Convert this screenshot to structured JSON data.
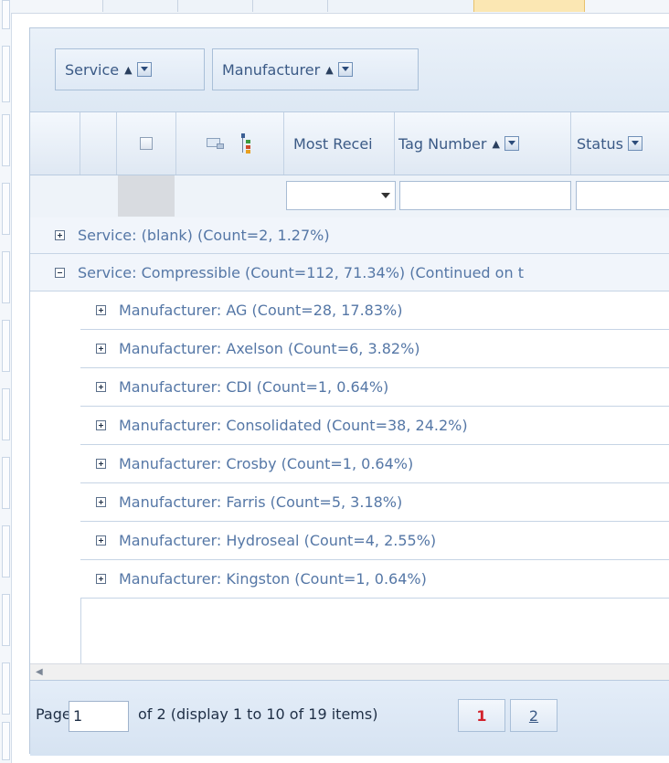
{
  "groupbar": {
    "chips": [
      {
        "label": "Service"
      },
      {
        "label": "Manufacturer"
      }
    ]
  },
  "columns": {
    "most_recent": "Most Recei",
    "tag_number": "Tag Number",
    "status": "Status"
  },
  "groups": {
    "blank": "Service: (blank) (Count=2, 1.27%)",
    "compressible": "Service: Compressible (Count=112, 71.34%) (Continued on t"
  },
  "manufacturers": [
    "Manufacturer: AG (Count=28, 17.83%)",
    "Manufacturer: Axelson (Count=6, 3.82%)",
    "Manufacturer: CDI (Count=1, 0.64%)",
    "Manufacturer: Consolidated (Count=38, 24.2%)",
    "Manufacturer: Crosby (Count=1, 0.64%)",
    "Manufacturer: Farris (Count=5, 3.18%)",
    "Manufacturer: Hydroseal (Count=4, 2.55%)",
    "Manufacturer: Kingston (Count=1, 0.64%)"
  ],
  "pager": {
    "page_label": "Page",
    "page_value": "1",
    "of_text": "of 2 (display 1 to 10 of 19 items)",
    "pages": [
      "1",
      "2"
    ],
    "current_page": "1"
  },
  "colors": {
    "accent_text": "#5577a6",
    "current_page": "#d2202a",
    "header_bg": "#dde8f4"
  }
}
